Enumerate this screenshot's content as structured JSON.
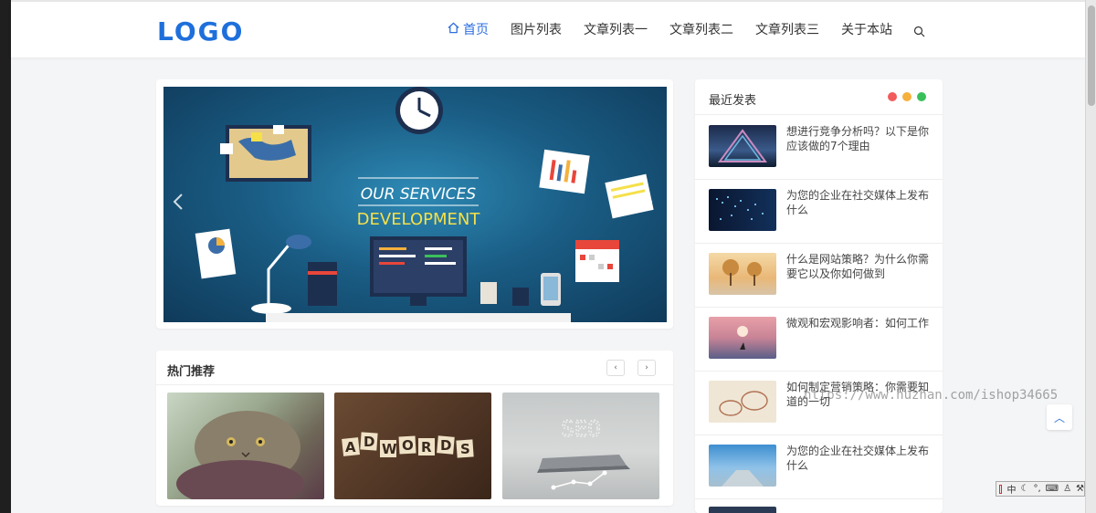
{
  "header": {
    "logo": "LOGO",
    "nav": [
      {
        "label": "首页",
        "active": true,
        "icon": "home-icon"
      },
      {
        "label": "图片列表",
        "active": false
      },
      {
        "label": "文章列表一",
        "active": false
      },
      {
        "label": "文章列表二",
        "active": false
      },
      {
        "label": "文章列表三",
        "active": false
      },
      {
        "label": "关于本站",
        "active": false
      }
    ],
    "search_icon": "search-icon"
  },
  "slider": {
    "line1": "OUR SERVICES",
    "line2": "DEVELOPMENT",
    "prev_icon": "chevron-left-icon",
    "next_icon": "chevron-right-icon"
  },
  "hot": {
    "title": "热门推荐",
    "prev": "‹",
    "next": "›",
    "thumbs": [
      {
        "icon": "cat-photo"
      },
      {
        "icon": "adwords-tiles-photo",
        "text": "ADWORDS"
      },
      {
        "icon": "seo-laptop-photo",
        "text": "SEO"
      }
    ]
  },
  "recent": {
    "title": "最近发表",
    "dot_colors": [
      "#f25b5b",
      "#f5b13d",
      "#3ac05b"
    ],
    "posts": [
      {
        "title": "想进行竞争分析吗？以下是你应该做的7个理由"
      },
      {
        "title": "为您的企业在社交媒体上发布什么"
      },
      {
        "title": "什么是网站策略？为什么你需要它以及你如何做到"
      },
      {
        "title": "微观和宏观影响者：如何工作"
      },
      {
        "title": "如何制定营销策略：你需要知道的一切"
      },
      {
        "title": "为您的企业在社交媒体上发布什么"
      }
    ]
  },
  "watermark": "https://www.huzhan.com/ishop34665",
  "back_to_top": "︿",
  "ime": {
    "label": "中"
  },
  "colors": {
    "accent": "#2e6fe0",
    "logo": "#1e6fdb"
  }
}
